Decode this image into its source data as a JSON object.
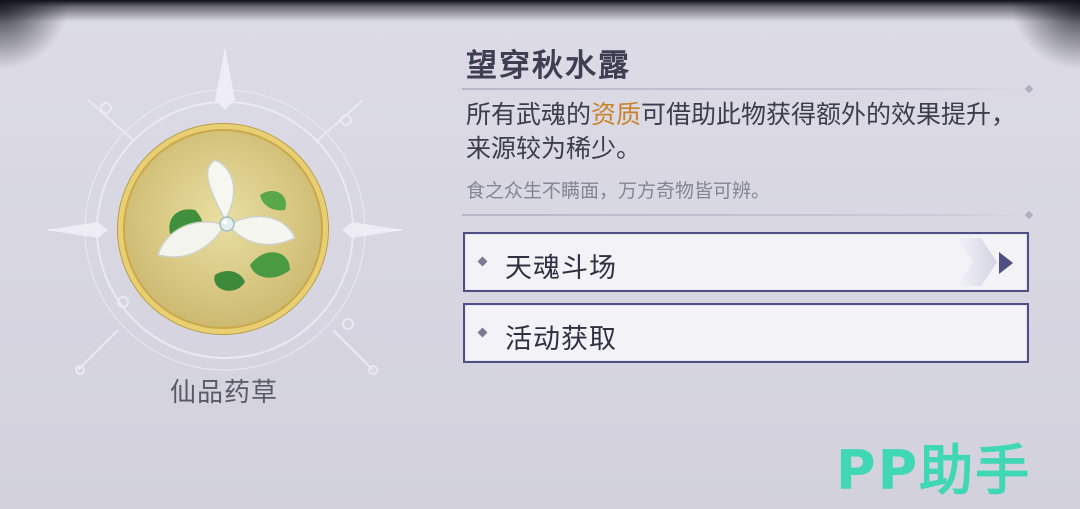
{
  "item": {
    "name": "仙品药草",
    "icon": "white-flower-herb-icon",
    "frame_color": "#d4b95a"
  },
  "detail": {
    "title": "望穿秋水露",
    "description_before": "所有武魂的",
    "description_highlight": "资质",
    "description_after": "可借助此物获得额外的效果提升，来源较为稀少。",
    "flavor_text": "食之众生不瞒面，万方奇物皆可辨。",
    "highlight_color": "#c8832c"
  },
  "sources": [
    {
      "label": "天魂斗场",
      "has_arrow": true
    },
    {
      "label": "活动获取",
      "has_arrow": false
    }
  ],
  "watermark": "PP助手"
}
